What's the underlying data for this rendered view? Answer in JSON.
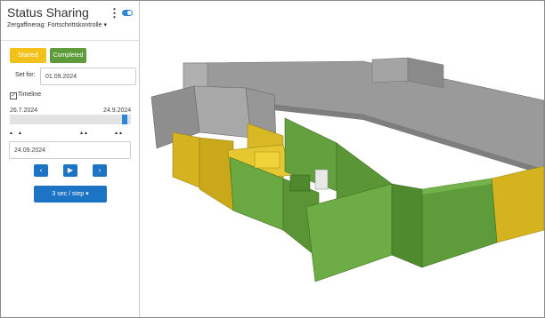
{
  "sidebar": {
    "title": "Status Sharing",
    "subtitle": "Zergaffinerag: Fortschrittskontrolle",
    "subtitle_caret": "▾",
    "menu_icon": "⋮",
    "toggle_on": true,
    "status_buttons": {
      "started": "Started",
      "completed": "Completed"
    },
    "set_for_label": "Set for:",
    "set_for_value": "01.09.2024",
    "timeline_label": "Timeline",
    "timeline_checked": true,
    "timeline": {
      "start": "26.7.2024",
      "end": "24.9.2024",
      "position": 0.97,
      "marks": [
        "▲",
        "▲",
        "▲▲",
        "▲▲"
      ]
    },
    "current_date": "24.09.2024",
    "controls": {
      "prev": "‹",
      "play": "▶",
      "next": "›"
    },
    "speed_label": "3 sec / step ▾"
  },
  "colors": {
    "accent": "#1e74c4",
    "started": "#f2c21a",
    "completed": "#5e9b3a",
    "wall_green": "#5e9b3a",
    "wall_yellow": "#d4b31f",
    "wall_grey": "#8d8d8d"
  }
}
